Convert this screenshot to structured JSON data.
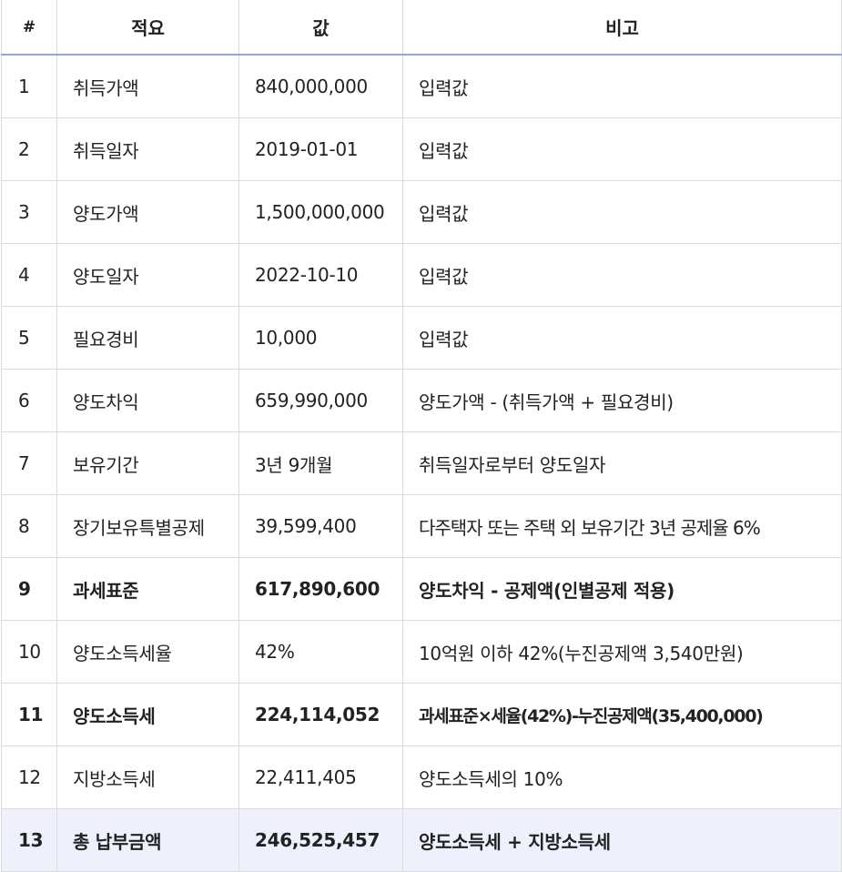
{
  "header": {
    "num": "#",
    "item": "적요",
    "value": "값",
    "note": "비고"
  },
  "rows": [
    {
      "num": "1",
      "item": "취득가액",
      "value": "840,000,000",
      "note": "입력값"
    },
    {
      "num": "2",
      "item": "취득일자",
      "value": "2019-01-01",
      "note": "입력값"
    },
    {
      "num": "3",
      "item": "양도가액",
      "value": "1,500,000,000",
      "note": "입력값"
    },
    {
      "num": "4",
      "item": "양도일자",
      "value": "2022-10-10",
      "note": "입력값"
    },
    {
      "num": "5",
      "item": "필요경비",
      "value": "10,000",
      "note": "입력값"
    },
    {
      "num": "6",
      "item": "양도차익",
      "value": "659,990,000",
      "note": "양도가액 - (취득가액 + 필요경비)"
    },
    {
      "num": "7",
      "item": "보유기간",
      "value": "3년 9개월",
      "note": "취득일자로부터 양도일자"
    },
    {
      "num": "8",
      "item": "장기보유특별공제",
      "value": "39,599,400",
      "note": "다주택자 또는 주택 외 보유기간 3년 공제율 6%"
    },
    {
      "num": "9",
      "item": "과세표준",
      "value": "617,890,600",
      "note": "양도차익 - 공제액(인별공제 적용)"
    },
    {
      "num": "10",
      "item": "양도소득세율",
      "value": "42%",
      "note": "10억원 이하 42%(누진공제액 3,540만원)"
    },
    {
      "num": "11",
      "item": "양도소득세",
      "value": "224,114,052",
      "note": "과세표준×세율(42%)-누진공제액(35,400,000)"
    },
    {
      "num": "12",
      "item": "지방소득세",
      "value": "22,411,405",
      "note": "양도소득세의 10%"
    },
    {
      "num": "13",
      "item": "총 납부금액",
      "value": "246,525,457",
      "note": "양도소득세 + 지방소득세"
    }
  ],
  "colors": {
    "header_rule": "#8fa8e0",
    "total_row_bg": "#eef0fb",
    "grid": "#dcdcdc"
  }
}
